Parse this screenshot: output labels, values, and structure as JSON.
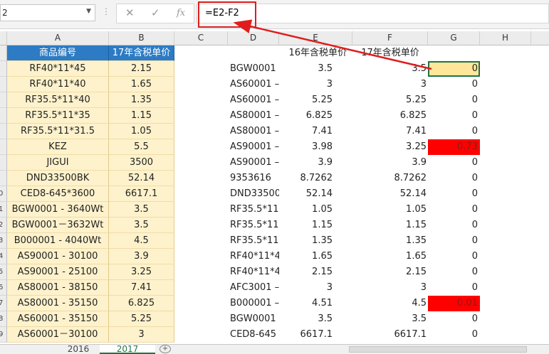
{
  "formula_bar": {
    "name_box": "2",
    "formula": "=E2-F2"
  },
  "columns": [
    "A",
    "B",
    "C",
    "D",
    "E",
    "F",
    "G",
    "H"
  ],
  "header": {
    "a": "商品编号",
    "b": "17年含税单价",
    "e": "16年含税单价",
    "f": "17年含税单价"
  },
  "rows": [
    {
      "rn": "",
      "a": "RF40*11*45",
      "b": "2.15",
      "d": "BGW0001 -",
      "e": "3.5",
      "f": "3.5",
      "g": "0"
    },
    {
      "rn": "",
      "a": "RF40*11*40",
      "b": "1.65",
      "d": "AS60001 –",
      "e": "3",
      "f": "3",
      "g": "0"
    },
    {
      "rn": "",
      "a": "RF35.5*11*40",
      "b": "1.35",
      "d": "AS60001 –",
      "e": "5.25",
      "f": "5.25",
      "g": "0"
    },
    {
      "rn": "",
      "a": "RF35.5*11*35",
      "b": "1.15",
      "d": "AS80001 –",
      "e": "6.825",
      "f": "6.825",
      "g": "0"
    },
    {
      "rn": "",
      "a": "RF35.5*11*31.5",
      "b": "1.05",
      "d": "AS80001 –",
      "e": "7.41",
      "f": "7.41",
      "g": "0"
    },
    {
      "rn": "",
      "a": "KEZ",
      "b": "5.5",
      "d": "AS90001 –",
      "e": "3.98",
      "f": "3.25",
      "g": "0.73"
    },
    {
      "rn": "",
      "a": "JIGUI",
      "b": "3500",
      "d": "AS90001 –",
      "e": "3.9",
      "f": "3.9",
      "g": "0"
    },
    {
      "rn": "",
      "a": "DND33500BK",
      "b": "52.14",
      "d": "9353616",
      "e": "8.7262",
      "f": "8.7262",
      "g": "0"
    },
    {
      "rn": "0",
      "a": "CED8-645*3600",
      "b": "6617.1",
      "d": "DND33500",
      "e": "52.14",
      "f": "52.14",
      "g": "0"
    },
    {
      "rn": "1",
      "a": "BGW0001 - 3640Wt",
      "b": "3.5",
      "d": "RF35.5*11*",
      "e": "1.05",
      "f": "1.05",
      "g": "0"
    },
    {
      "rn": "2",
      "a": "BGW0001－3632Wt",
      "b": "3.5",
      "d": "RF35.5*11*",
      "e": "1.15",
      "f": "1.15",
      "g": "0"
    },
    {
      "rn": "3",
      "a": "B000001 - 4040Wt",
      "b": "4.5",
      "d": "RF35.5*11*",
      "e": "1.35",
      "f": "1.35",
      "g": "0"
    },
    {
      "rn": "4",
      "a": "AS90001 - 30100",
      "b": "3.9",
      "d": "RF40*11*4",
      "e": "1.65",
      "f": "1.65",
      "g": "0"
    },
    {
      "rn": "5",
      "a": "AS90001 - 25100",
      "b": "3.25",
      "d": "RF40*11*4",
      "e": "2.15",
      "f": "2.15",
      "g": "0"
    },
    {
      "rn": "6",
      "a": "AS80001 - 38150",
      "b": "7.41",
      "d": "AFC3001 –",
      "e": "3",
      "f": "3",
      "g": "0"
    },
    {
      "rn": "7",
      "a": "AS80001 - 35150",
      "b": "6.825",
      "d": "B000001 –",
      "e": "4.51",
      "f": "4.5",
      "g": "0.01"
    },
    {
      "rn": "8",
      "a": "AS60001 - 35150",
      "b": "5.25",
      "d": "BGW0001 -",
      "e": "3.5",
      "f": "3.5",
      "g": "0"
    },
    {
      "rn": "9",
      "a": "AS60001－30100",
      "b": "3",
      "d": "CED8-645",
      "e": "6617.1",
      "f": "6617.1",
      "g": "0"
    }
  ],
  "tabs": [
    "2016",
    "2017"
  ],
  "colors": {
    "header_blue": "#2c7bc4",
    "cell_yellow": "#fef2cc",
    "highlight_red": "#ff0000",
    "selected": "#ffe699",
    "annotation": "#e01d1d"
  }
}
